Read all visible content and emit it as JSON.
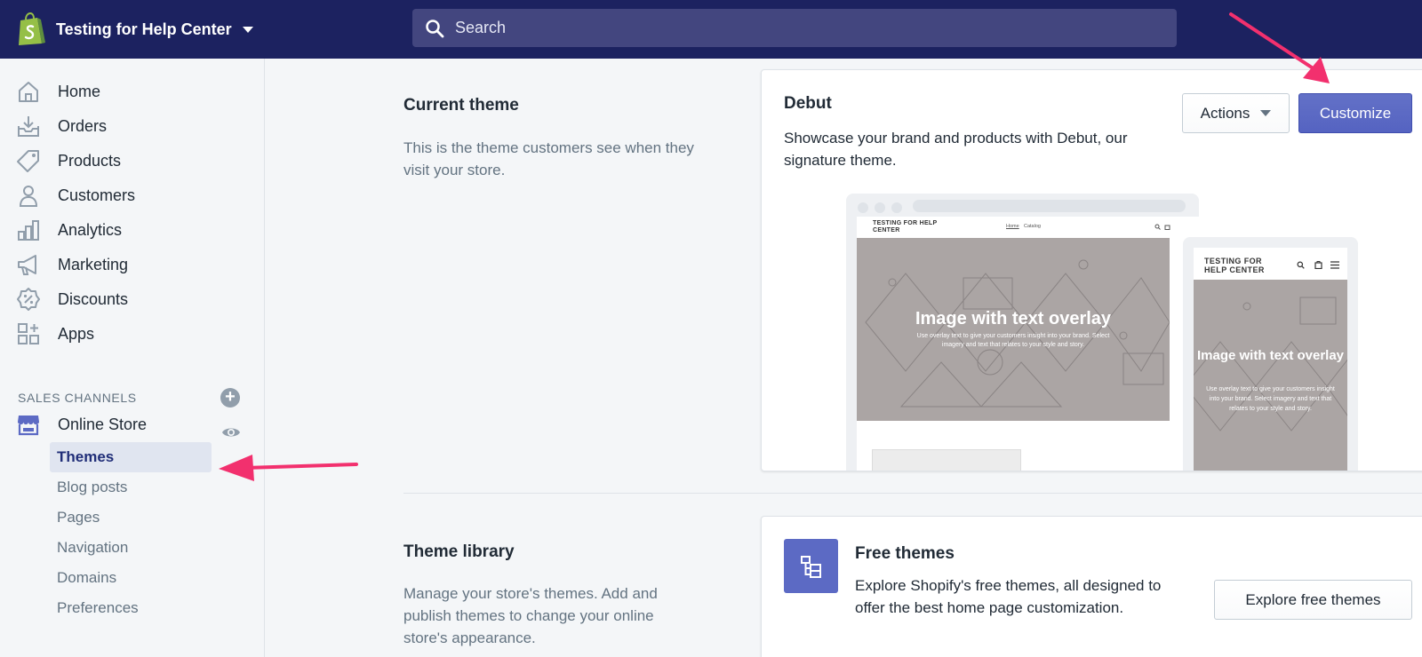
{
  "store": {
    "name": "Testing for Help Center",
    "logo_icon": "shopify-bag-icon"
  },
  "search": {
    "placeholder": "Search"
  },
  "sidebar": {
    "items": [
      {
        "label": "Home",
        "icon": "home-icon"
      },
      {
        "label": "Orders",
        "icon": "orders-icon"
      },
      {
        "label": "Products",
        "icon": "tag-icon"
      },
      {
        "label": "Customers",
        "icon": "person-icon"
      },
      {
        "label": "Analytics",
        "icon": "bar-chart-icon"
      },
      {
        "label": "Marketing",
        "icon": "megaphone-icon"
      },
      {
        "label": "Discounts",
        "icon": "discount-icon"
      },
      {
        "label": "Apps",
        "icon": "apps-icon"
      }
    ],
    "sales_channels_title": "SALES CHANNELS",
    "online_store": {
      "label": "Online Store",
      "subitems": [
        "Themes",
        "Blog posts",
        "Pages",
        "Navigation",
        "Domains",
        "Preferences"
      ],
      "active": "Themes"
    }
  },
  "current_theme": {
    "section_title": "Current theme",
    "section_desc": "This is the theme customers see when they visit your store.",
    "name": "Debut",
    "description": "Showcase your brand and products with Debut, our signature theme.",
    "actions_label": "Actions",
    "customize_label": "Customize",
    "preview": {
      "brand": "TESTING FOR HELP CENTER",
      "nav_home": "Home",
      "nav_catalog": "Catalog",
      "hero_title": "Image with text overlay",
      "hero_text": "Use overlay text to give your customers insight into your brand. Select imagery and text that relates to your style and story."
    }
  },
  "theme_library": {
    "section_title": "Theme library",
    "section_desc": "Manage your store's themes. Add and publish themes to change your online store's appearance.",
    "free_title": "Free themes",
    "free_desc": "Explore Shopify's free themes, all designed to offer the best home page customization.",
    "explore_label": "Explore free themes"
  },
  "colors": {
    "topbar": "#1c2260",
    "search_bg": "#43467f",
    "primary": "#5c6ac4",
    "active_nav_bg": "#e0e5f0",
    "annotation_arrow": "#f2306e"
  }
}
